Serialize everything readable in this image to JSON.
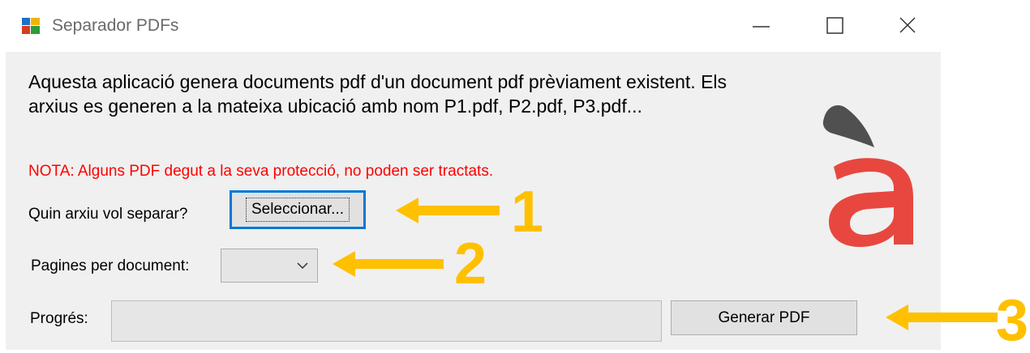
{
  "window": {
    "title": "Separador PDFs"
  },
  "content": {
    "description": "Aquesta aplicació genera documents pdf d'un document pdf prèviament existent.  Els arxius es generen a la mateixa ubicació amb nom P1.pdf, P2.pdf, P3.pdf...",
    "nota": "NOTA: Alguns PDF degut a la seva protecció, no poden ser tractats.",
    "file_label": "Quin arxiu vol separar?",
    "select_button": "Seleccionar...",
    "pages_label": "Pagines per document:",
    "pages_value": "",
    "progress_label": "Progrés:",
    "progress_value": 0,
    "generate_button": "Generar PDF"
  },
  "annotations": [
    {
      "number": "1"
    },
    {
      "number": "2"
    },
    {
      "number": "3"
    }
  ],
  "colors": {
    "annotation": "#ffc000",
    "nota_text": "#ff0000",
    "logo_red": "#e8473f",
    "logo_grave": "#505050",
    "focus_border": "#0078d7"
  }
}
